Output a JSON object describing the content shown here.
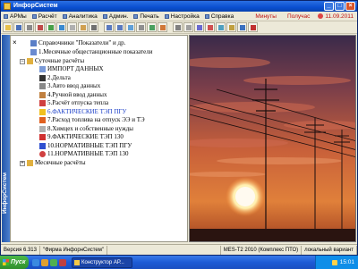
{
  "window": {
    "title": "ИнфорСистем"
  },
  "menu": {
    "items": [
      {
        "label": "АРМы"
      },
      {
        "label": "Расчёт"
      },
      {
        "label": "Аналитика"
      },
      {
        "label": "Админ."
      },
      {
        "label": "Печать"
      },
      {
        "label": "Настройка"
      },
      {
        "label": "Справка"
      }
    ],
    "status_left": "Минуты",
    "status_right": "Получас",
    "date": "11.09.2011"
  },
  "sidebar": {
    "vertical_label": "ИнфорСистем"
  },
  "tree": {
    "nodes": [
      {
        "label": "Справочники \"Показатели\" и др."
      },
      {
        "label": "1.Месячные общестанционные показатели"
      },
      {
        "label": "Суточные расчёты"
      },
      {
        "label": "ИМПОРТ ДАННЫХ"
      },
      {
        "label": "2.Дельта"
      },
      {
        "label": "3.Авто ввод данных"
      },
      {
        "label": "4.Ручной ввод данных"
      },
      {
        "label": "5.Расчёт отпуска тепла"
      },
      {
        "label": "6.ФАКТИЧЕСКИЕ ТЭП ПГУ"
      },
      {
        "label": "7.Расход топлива на отпуск ЭЭ и ТЭ"
      },
      {
        "label": "8.Химцех и собственные нужды"
      },
      {
        "label": "9.ФАКТИЧЕСКИЕ ТЭП 130"
      },
      {
        "label": "10.НОРМАТИВНЫЕ ТЭП ПГУ"
      },
      {
        "label": "11.НОРМАТИВНЫЕ ТЭП 130"
      },
      {
        "label": "Месячные расчёты"
      }
    ]
  },
  "statusbar": {
    "version": "Версия 6.313",
    "company": "\"Фирма ИнфорнСистем\"",
    "product": "MES-T2  2010  (Комплекс ПТО)",
    "mode": "локальный вариант"
  },
  "taskbar": {
    "start_label": "Пуск",
    "task_label": "Конструктор АР...",
    "clock": "15:01"
  },
  "colors": {
    "accent": "#0a4fd0",
    "alert": "#c01010"
  }
}
